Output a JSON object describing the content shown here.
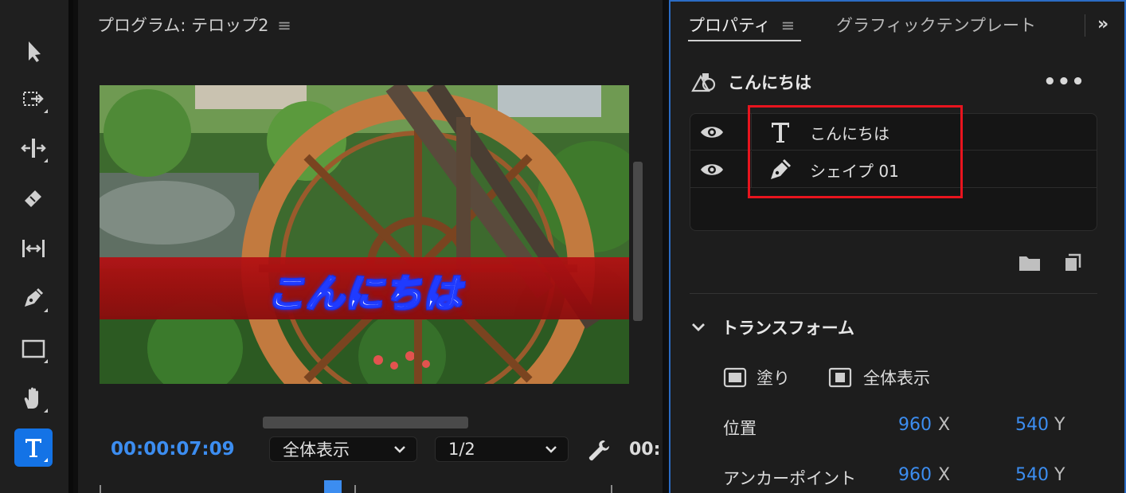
{
  "toolbar": {
    "tools": [
      {
        "name": "selection-tool",
        "icon": "arrow-icon"
      },
      {
        "name": "track-select-tool",
        "icon": "track-select-icon"
      },
      {
        "name": "ripple-edit-tool",
        "icon": "ripple-edit-icon"
      },
      {
        "name": "razor-tool",
        "icon": "razor-icon"
      },
      {
        "name": "slip-tool",
        "icon": "slip-icon"
      },
      {
        "name": "pen-tool",
        "icon": "pen-icon"
      },
      {
        "name": "rectangle-tool",
        "icon": "rectangle-icon"
      },
      {
        "name": "hand-tool",
        "icon": "hand-icon"
      },
      {
        "name": "type-tool",
        "icon": "type-icon",
        "active": true
      }
    ],
    "active_color": "#1473e6"
  },
  "program_monitor": {
    "title": "プログラム: テロップ2",
    "menu_icon": "≡",
    "caption_text": "こんにちは",
    "caption_bar_color": "#b40f12",
    "timecode": "00:00:07:09",
    "fit_dropdown": "全体表示",
    "resolution_dropdown": "1/2",
    "timecode_right": "00:",
    "accent_color": "#3c8df0"
  },
  "properties": {
    "tab_active": "プロパティ",
    "tab_menu_icon": "≡",
    "tab_inactive": "グラフィックテンプレート",
    "more_tabs": "»",
    "layer_title": "こんにちは",
    "more_menu": "•••",
    "layers": [
      {
        "name": "こんにちは",
        "type_icon": "text-icon"
      },
      {
        "name": "シェイプ 01",
        "type_icon": "pen-icon"
      }
    ],
    "section_title": "トランスフォーム",
    "fill_label": "塗り",
    "fit_label": "全体表示",
    "position": {
      "label": "位置",
      "x": "960",
      "x_axis": "X",
      "y": "540",
      "y_axis": "Y"
    },
    "anchor": {
      "label": "アンカーポイント",
      "x": "960",
      "x_axis": "X",
      "y": "540",
      "y_axis": "Y"
    },
    "highlight_color": "#e8141e",
    "value_color": "#3c8df0"
  }
}
